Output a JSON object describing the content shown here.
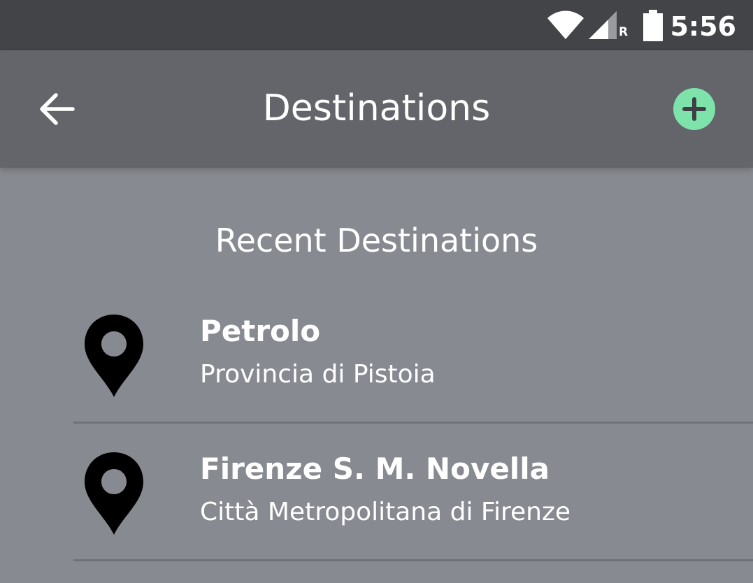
{
  "status_bar": {
    "time": "5:56",
    "roaming_label": "R",
    "icons": [
      "wifi-icon",
      "signal-icon",
      "battery-icon"
    ]
  },
  "app_bar": {
    "title": "Destinations",
    "back_icon": "arrow-left-icon",
    "add_icon": "plus-circle-icon",
    "add_color": "#7ee3aa"
  },
  "section": {
    "title": "Recent Destinations"
  },
  "destinations": [
    {
      "name": "Petrolo",
      "region": "Provincia di Pistoia",
      "icon": "map-pin-icon"
    },
    {
      "name": "Firenze S. M. Novella",
      "region": "Città Metropolitana di Firenze",
      "icon": "map-pin-icon"
    }
  ],
  "colors": {
    "status_bar_bg": "#434448",
    "app_bar_bg": "#64656a",
    "page_bg": "#888a91",
    "divider": "#707176",
    "text": "#ffffff"
  }
}
